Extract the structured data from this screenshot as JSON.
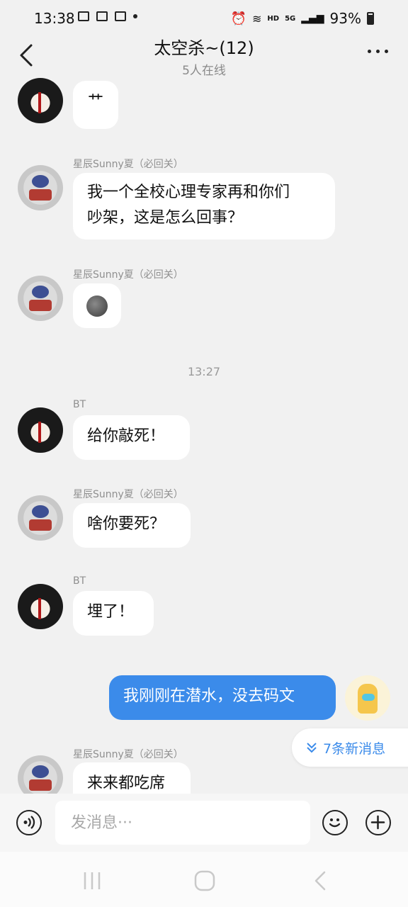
{
  "status_bar": {
    "time": "13:38",
    "battery": "93%",
    "network": "5G",
    "hd": "HD"
  },
  "header": {
    "title": "太空杀~(12)",
    "subtitle": "5人在线"
  },
  "messages": [
    {
      "sender": "",
      "text": "艹"
    },
    {
      "sender": "星辰Sunny夏（必回关）",
      "text_line1": "我一个全校心理专家再和你们",
      "text_line2": "吵架，这是怎么回事？"
    },
    {
      "sender": "星辰Sunny夏（必回关）",
      "text": ""
    },
    {
      "sender": "BT",
      "text": "给你敲死！"
    },
    {
      "sender": "星辰Sunny夏（必回关）",
      "text": "啥你要死？"
    },
    {
      "sender": "BT",
      "text": "埋了！"
    },
    {
      "sender": "",
      "text": "我刚刚在潜水，没去码文"
    },
    {
      "sender": "星辰Sunny夏（必回关）",
      "text": "来来都吃席"
    }
  ],
  "time_separator": "13:27",
  "new_messages_label": "7条新消息",
  "input": {
    "placeholder": "发消息···"
  }
}
